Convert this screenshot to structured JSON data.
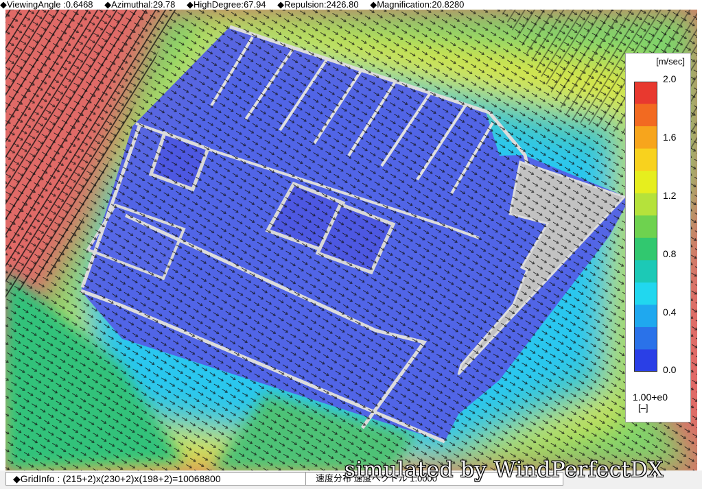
{
  "header": {
    "viewing_angle": "◆ViewingAngle :0.6468",
    "azimuthal": "◆Azimuthal:29.78",
    "high_degree": "◆HighDegree:67.94",
    "repulsion": "◆Repulsion:2426.80",
    "magnification": "◆Magnification:20.8280"
  },
  "legend": {
    "unit": "[m/sec]",
    "ticks": [
      "2.0",
      "1.6",
      "1.2",
      "0.8",
      "0.4",
      "0.0"
    ],
    "scale_value": "1.00+e0",
    "scale_unit": "[–]",
    "colors": [
      "#e8392f",
      "#f26a21",
      "#f7a51c",
      "#f8d21e",
      "#e6ee1e",
      "#b5e23b",
      "#6ed24f",
      "#31c86f",
      "#1cc9b6",
      "#21d7ef",
      "#1fa8ef",
      "#2a72e9",
      "#2a3fe6"
    ]
  },
  "status": {
    "grid_info": "◆GridInfo : (215+2)x(230+2)x(198+2)=10068800",
    "mode": "速度分布 速度ベクトル 1.0000"
  },
  "watermark": "simulated by WindPerfectDX"
}
